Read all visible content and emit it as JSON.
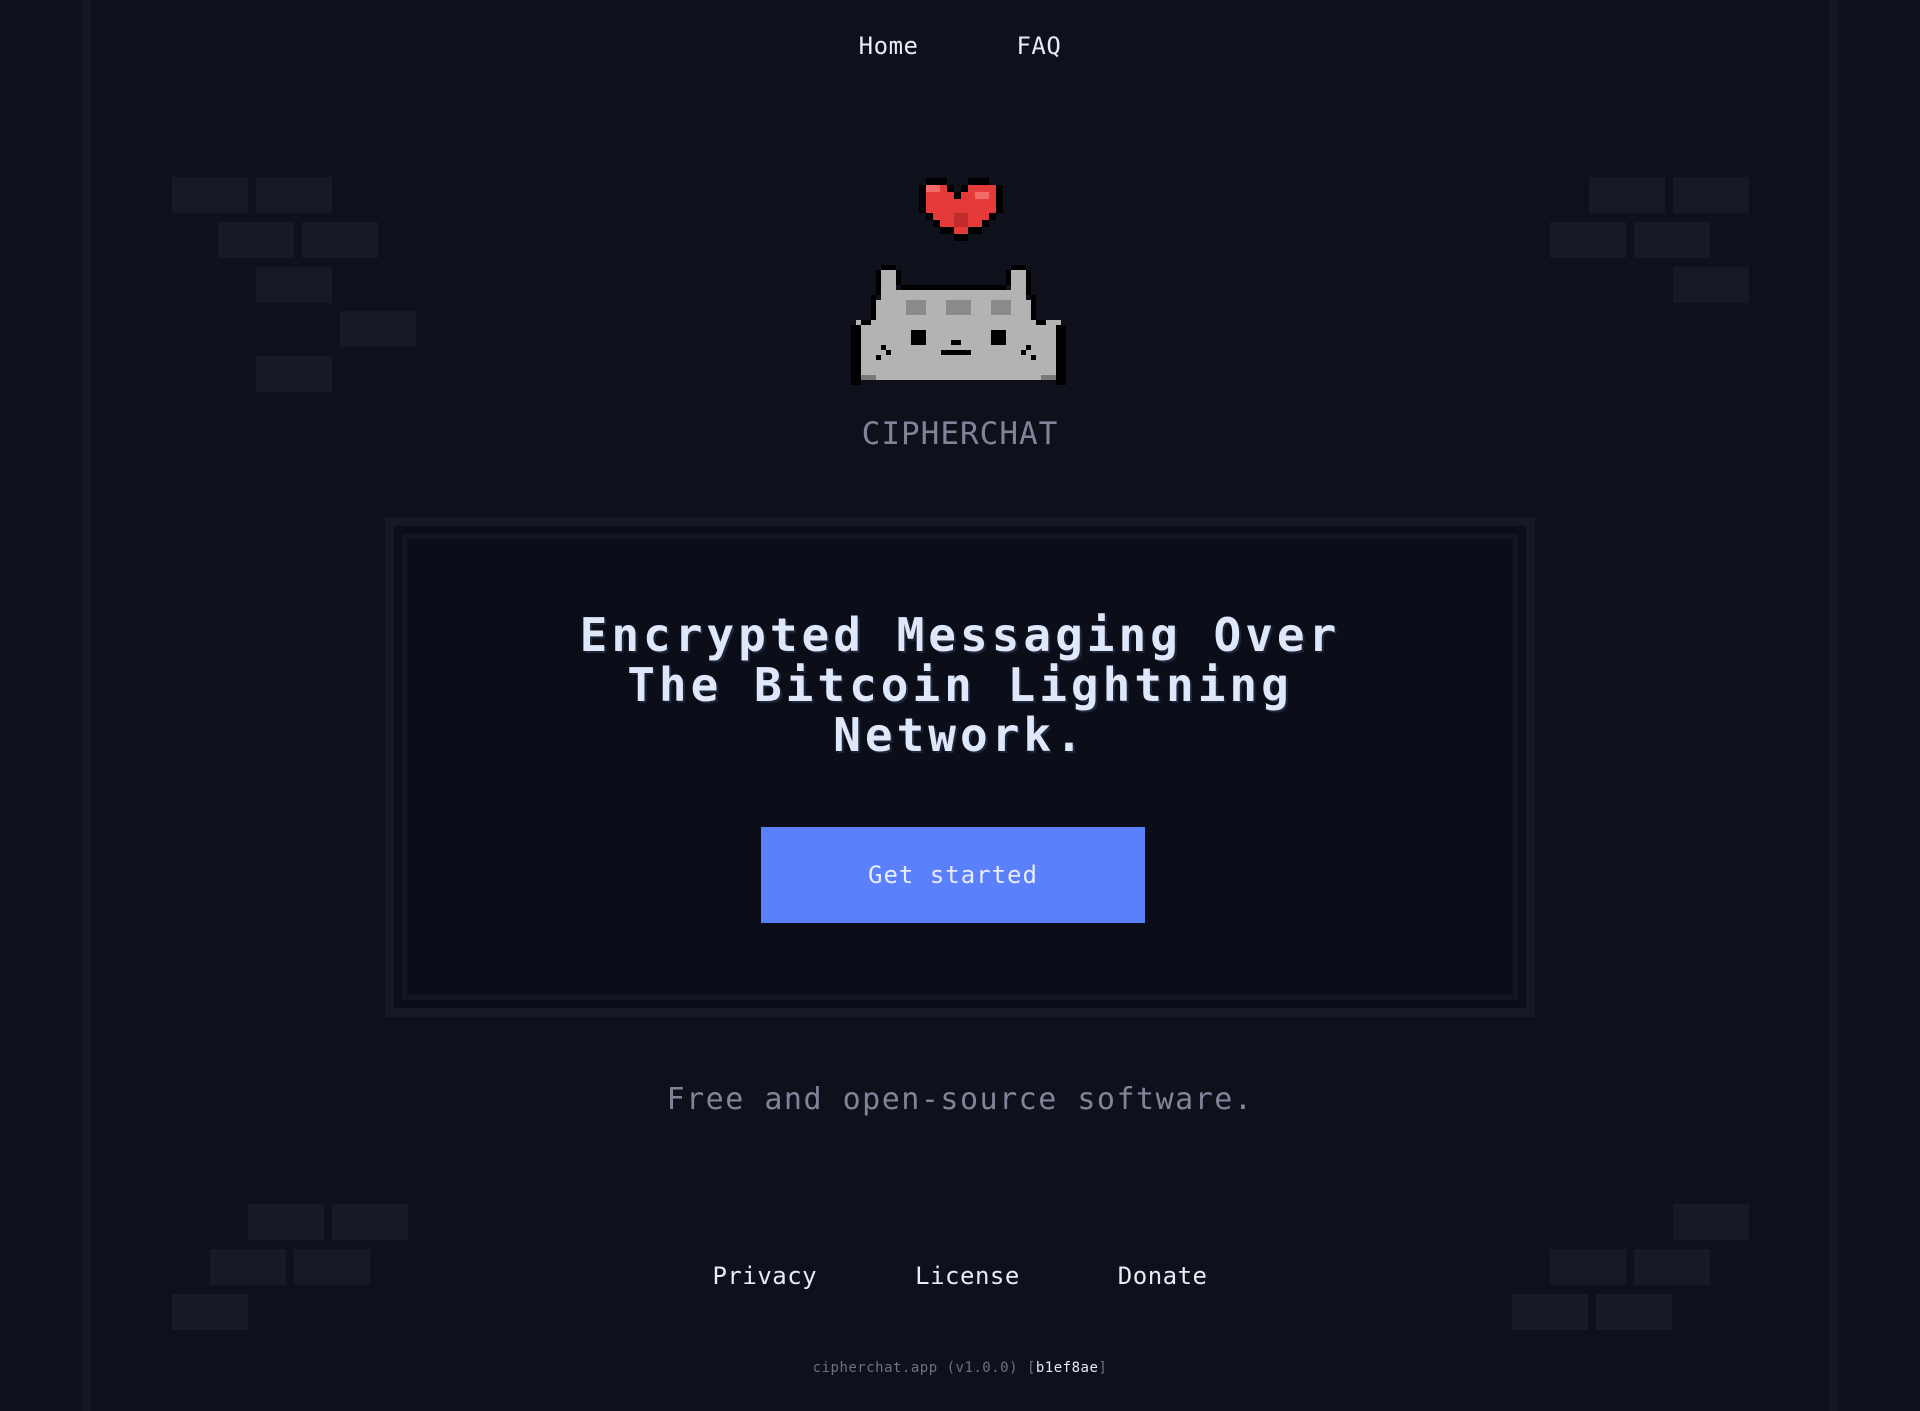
{
  "nav": {
    "home_label": "Home",
    "faq_label": "FAQ"
  },
  "icons": {
    "heart": "pixel-heart-icon",
    "mascot": "pixel-cat-icon"
  },
  "brand": {
    "name": "CIPHERCHAT"
  },
  "hero": {
    "line1": "Encrypted Messaging Over",
    "line2": "The Bitcoin Lightning",
    "line3": "Network.",
    "cta_label": "Get started"
  },
  "tagline": "Free and open-source software.",
  "footer": {
    "privacy_label": "Privacy",
    "license_label": "License",
    "donate_label": "Donate",
    "version_prefix": "cipherchat.app (v1.0.0) [",
    "commit_hash": "b1ef8ae",
    "version_suffix": "]"
  },
  "colors": {
    "background": "#0e111c",
    "accent": "#5b80fb",
    "heart": "#e53a3a",
    "muted_text": "#7f8499"
  }
}
